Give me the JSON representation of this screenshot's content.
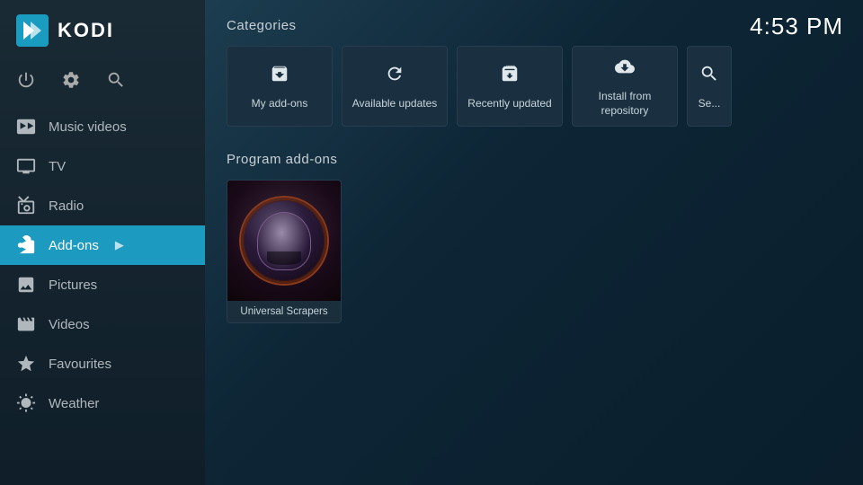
{
  "app": {
    "name": "KODI",
    "time": "4:53 PM"
  },
  "sidebar": {
    "controls": [
      {
        "id": "power",
        "label": "Power",
        "icon": "⏻"
      },
      {
        "id": "settings",
        "label": "Settings",
        "icon": "⚙"
      },
      {
        "id": "search",
        "label": "Search",
        "icon": "🔍"
      }
    ],
    "nav_items": [
      {
        "id": "music-videos",
        "label": "Music videos",
        "icon": "music-videos-icon",
        "active": false
      },
      {
        "id": "tv",
        "label": "TV",
        "icon": "tv-icon",
        "active": false
      },
      {
        "id": "radio",
        "label": "Radio",
        "icon": "radio-icon",
        "active": false
      },
      {
        "id": "add-ons",
        "label": "Add-ons",
        "icon": "addons-icon",
        "active": true
      },
      {
        "id": "pictures",
        "label": "Pictures",
        "icon": "pictures-icon",
        "active": false
      },
      {
        "id": "videos",
        "label": "Videos",
        "icon": "videos-icon",
        "active": false
      },
      {
        "id": "favourites",
        "label": "Favourites",
        "icon": "favourites-icon",
        "active": false
      },
      {
        "id": "weather",
        "label": "Weather",
        "icon": "weather-icon",
        "active": false
      }
    ]
  },
  "main": {
    "categories_title": "Categories",
    "program_addons_title": "Program add-ons",
    "categories": [
      {
        "id": "my-add-ons",
        "label": "My add-ons",
        "icon": "box-icon"
      },
      {
        "id": "available-updates",
        "label": "Available updates",
        "icon": "refresh-icon"
      },
      {
        "id": "recently-updated",
        "label": "Recently updated",
        "icon": "box-star-icon"
      },
      {
        "id": "install-from-repository",
        "label": "Install from\nrepository",
        "icon": "cloud-download-icon"
      },
      {
        "id": "search",
        "label": "Se...",
        "icon": "search-icon"
      }
    ],
    "program_addons": [
      {
        "id": "universal-scrapers",
        "label": "Universal Scrapers"
      }
    ]
  }
}
